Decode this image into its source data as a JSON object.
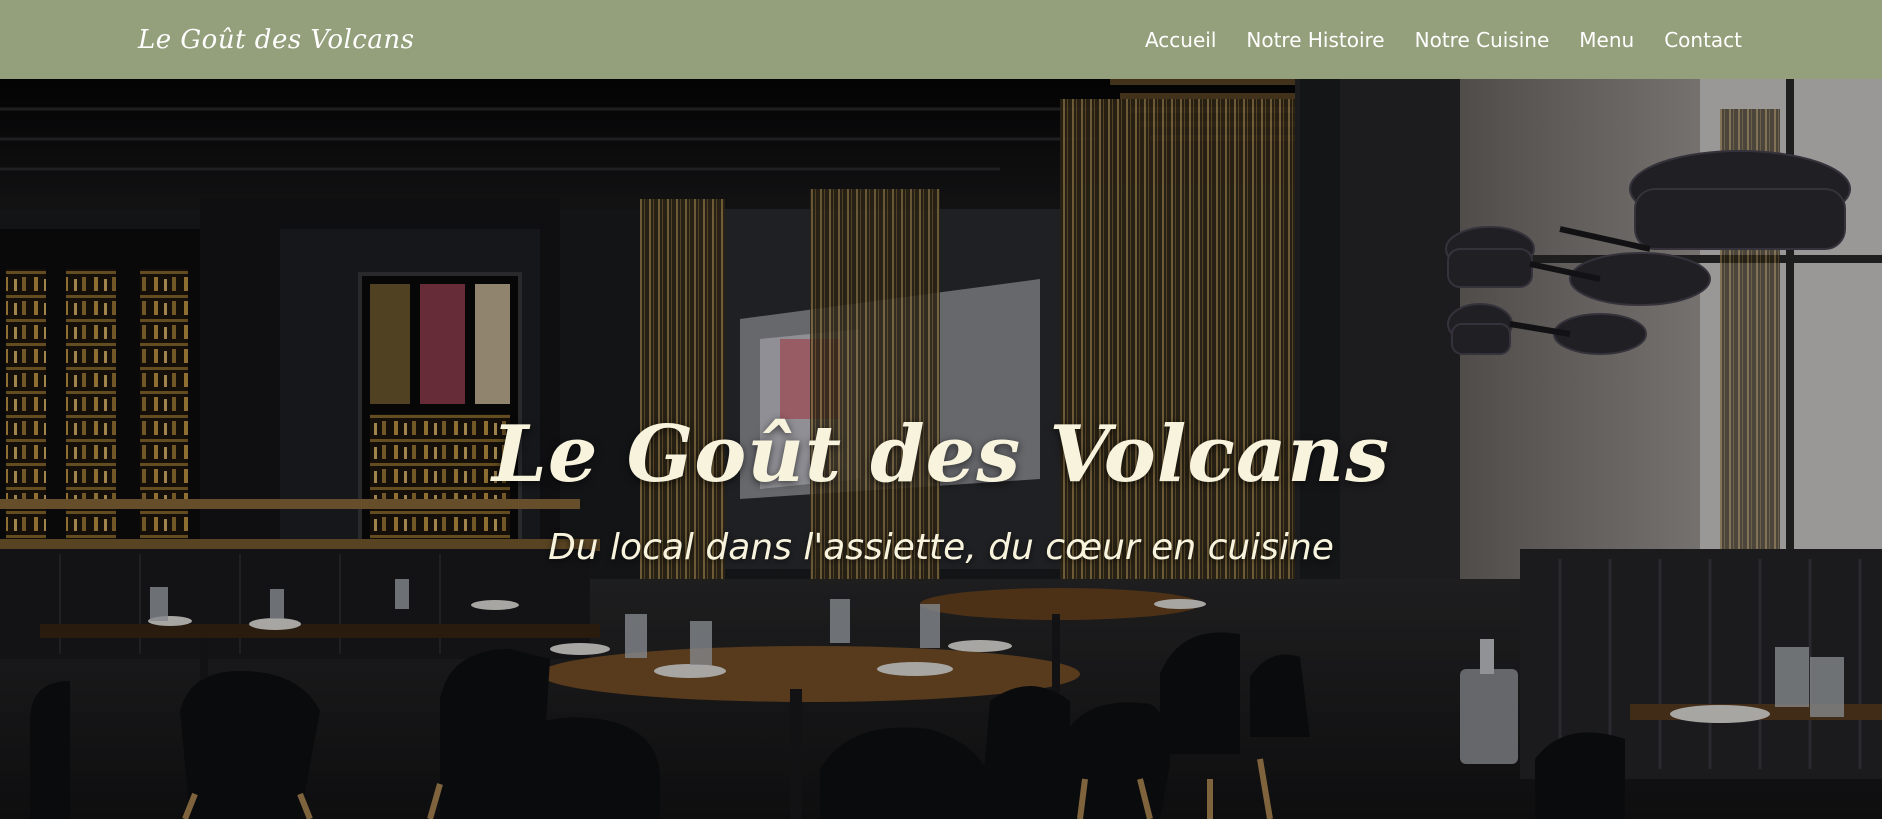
{
  "header": {
    "logo": "Le Goût des Volcans",
    "nav": [
      {
        "label": "Accueil"
      },
      {
        "label": "Notre Histoire"
      },
      {
        "label": "Notre Cuisine"
      },
      {
        "label": "Menu"
      },
      {
        "label": "Contact"
      }
    ]
  },
  "hero": {
    "title": "Le Goût des Volcans",
    "subtitle": "Du local dans l'assiette, du cœur en cuisine"
  },
  "colors": {
    "navbar": "#949f7b",
    "hero_text": "#f7f3dc"
  }
}
